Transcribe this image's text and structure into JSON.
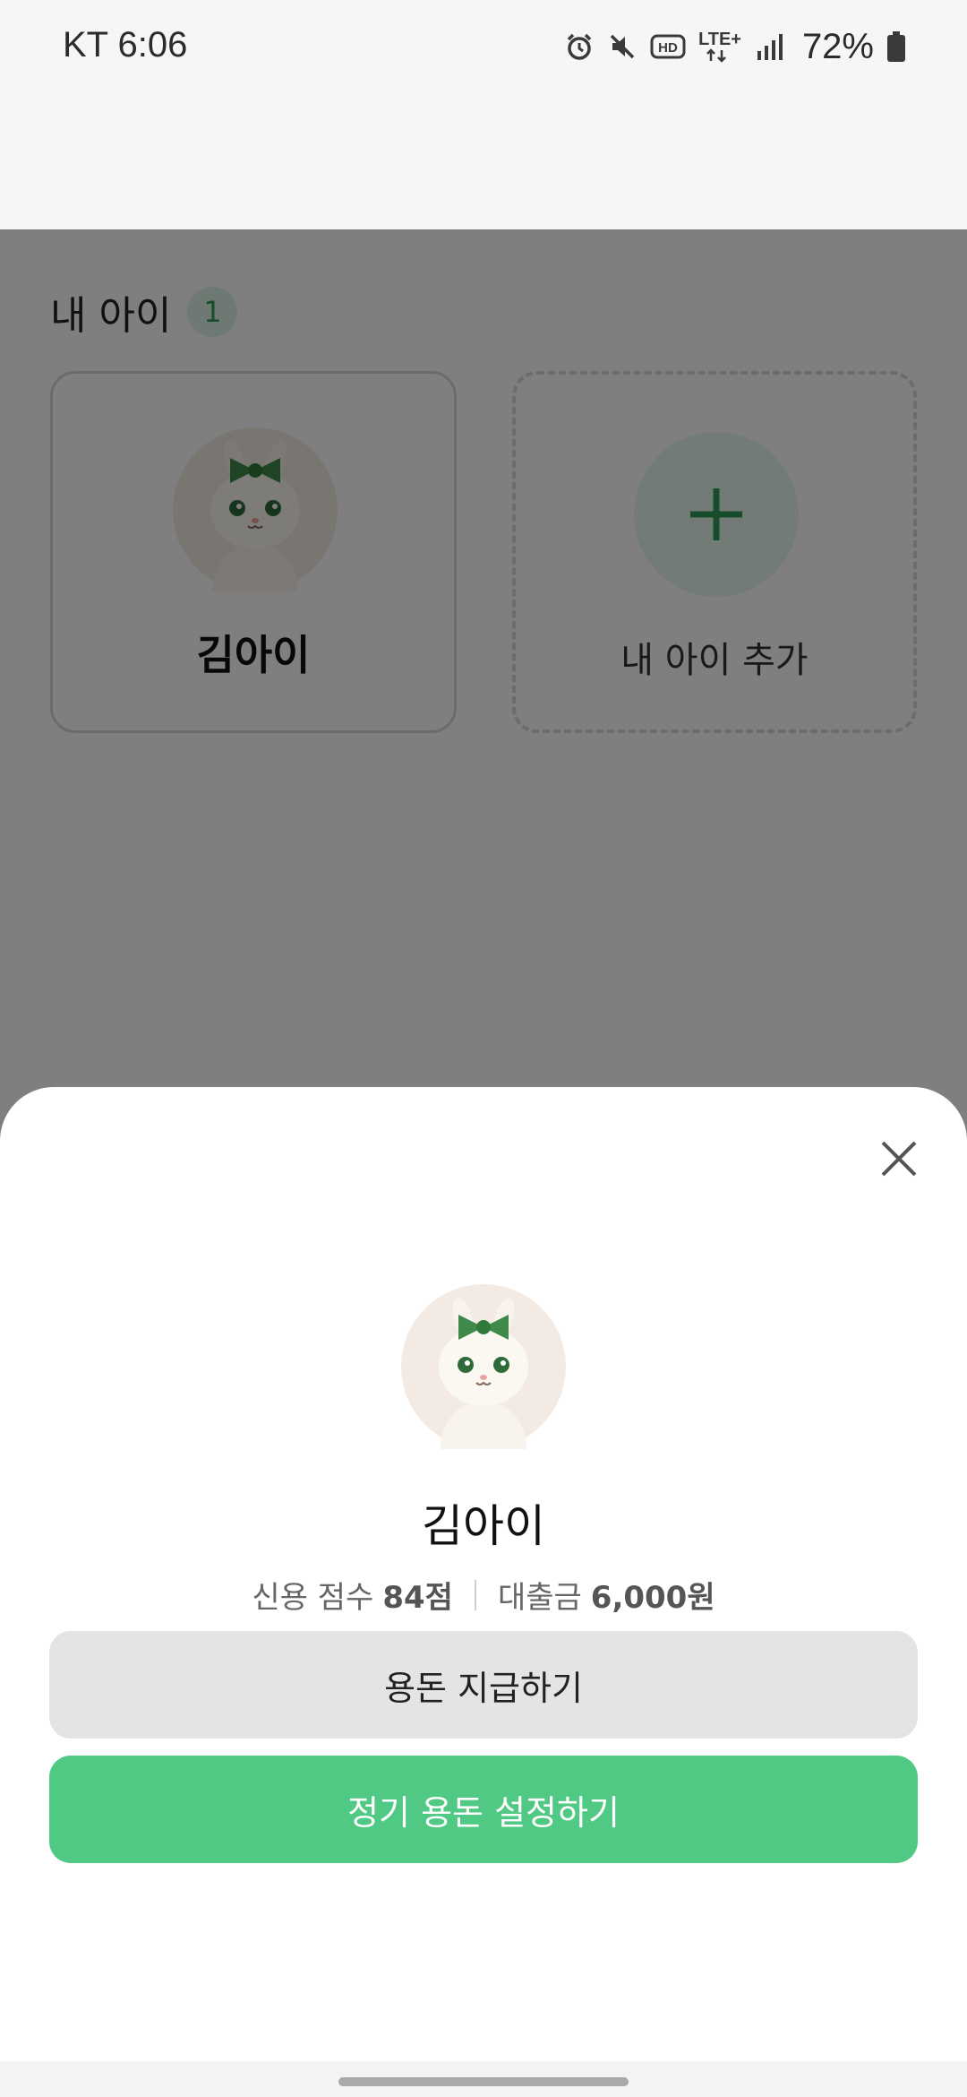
{
  "status_bar": {
    "carrier_time": "KT 6:06",
    "network": "LTE+",
    "hd_label": "HD",
    "battery": "72%",
    "icons": [
      "alarm-icon",
      "mute-icon",
      "hd-icon",
      "lte-icon",
      "signal-icon",
      "battery-icon"
    ]
  },
  "section": {
    "title": "내 아이",
    "count": "1"
  },
  "children": [
    {
      "name": "김아이",
      "avatar": "bunny-with-green-bow"
    }
  ],
  "add_card": {
    "label": "내 아이 추가",
    "icon": "plus-icon"
  },
  "sheet": {
    "name": "김아이",
    "credit_label": "신용 점수",
    "credit_value": "84점",
    "loan_label": "대출금",
    "loan_value": "6,000원",
    "pay_button": "용돈 지급하기",
    "regular_button": "정기 용돈 설정하기"
  },
  "colors": {
    "accent": "#4fc983",
    "badge_bg": "#dff3e6",
    "badge_text": "#2d9a55",
    "scrim": "rgba(0,0,0,0.5)"
  }
}
